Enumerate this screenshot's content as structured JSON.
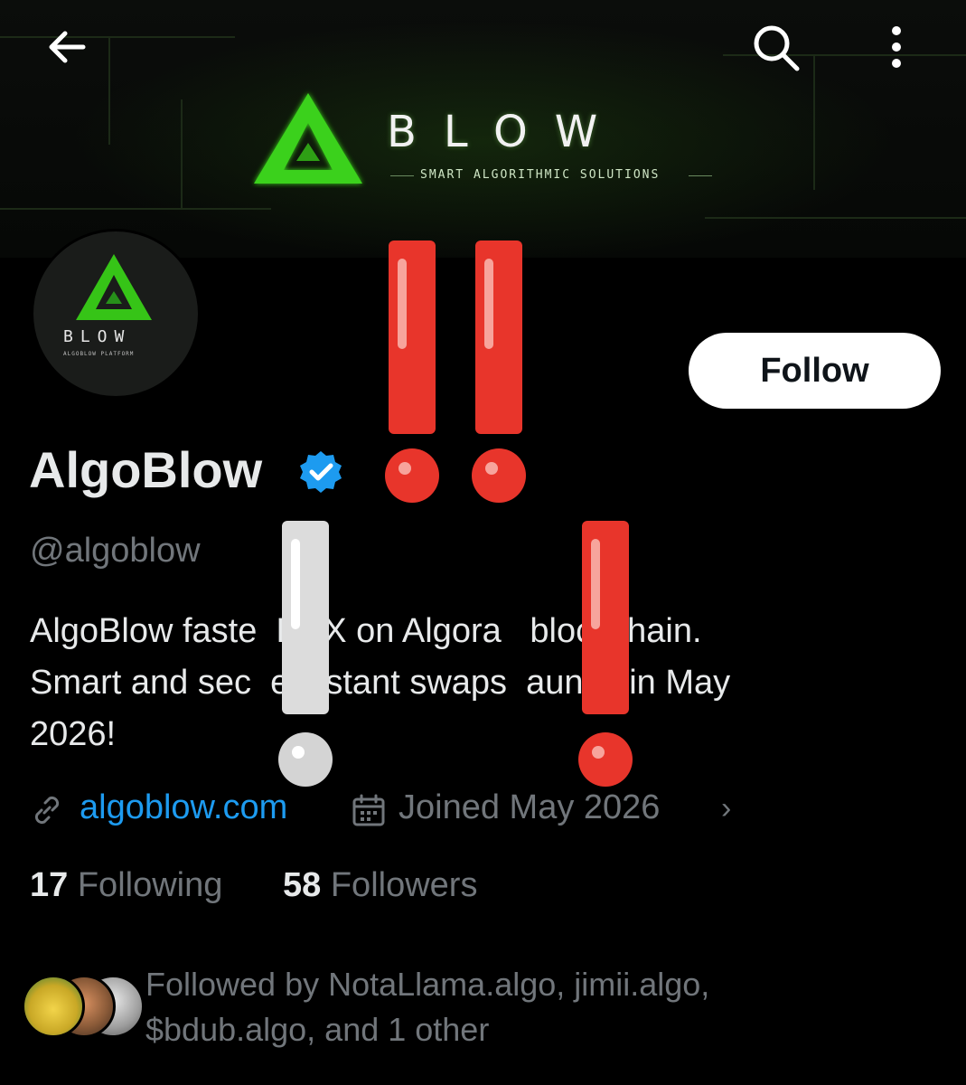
{
  "topbar": {
    "back_icon": "arrow-left-icon",
    "search_icon": "search-icon",
    "more_icon": "more-vertical-icon"
  },
  "banner": {
    "brand": "BLOW",
    "tagline": "SMART ALGORITHMIC SOLUTIONS",
    "accent": "#39ff14"
  },
  "avatar": {
    "brand": "BLOW",
    "sub": "ALGOBLOW PLATFORM"
  },
  "profile": {
    "follow_label": "Follow",
    "display_name": "AlgoBlow",
    "handle": "@algoblow",
    "bio_lines": [
      "AlgoBlow faste  DEX on Algora   blockchain.",
      "Smart and sec  e instant swaps  aunch in May",
      "2026!"
    ],
    "website": "algoblow.com",
    "joined": "Joined May 2026",
    "following_count": "17",
    "following_label": "Following",
    "followers_count": "58",
    "followers_label": "Followers",
    "followed_by_line1": "Followed by NotaLlama.algo, jimii.algo,",
    "followed_by_line2": "$bdub.algo, and 1 other"
  },
  "colors": {
    "link": "#1d9bf0",
    "muted": "#71767b",
    "verified": "#1d9bf0",
    "exclamation_red": "#e8352b"
  }
}
